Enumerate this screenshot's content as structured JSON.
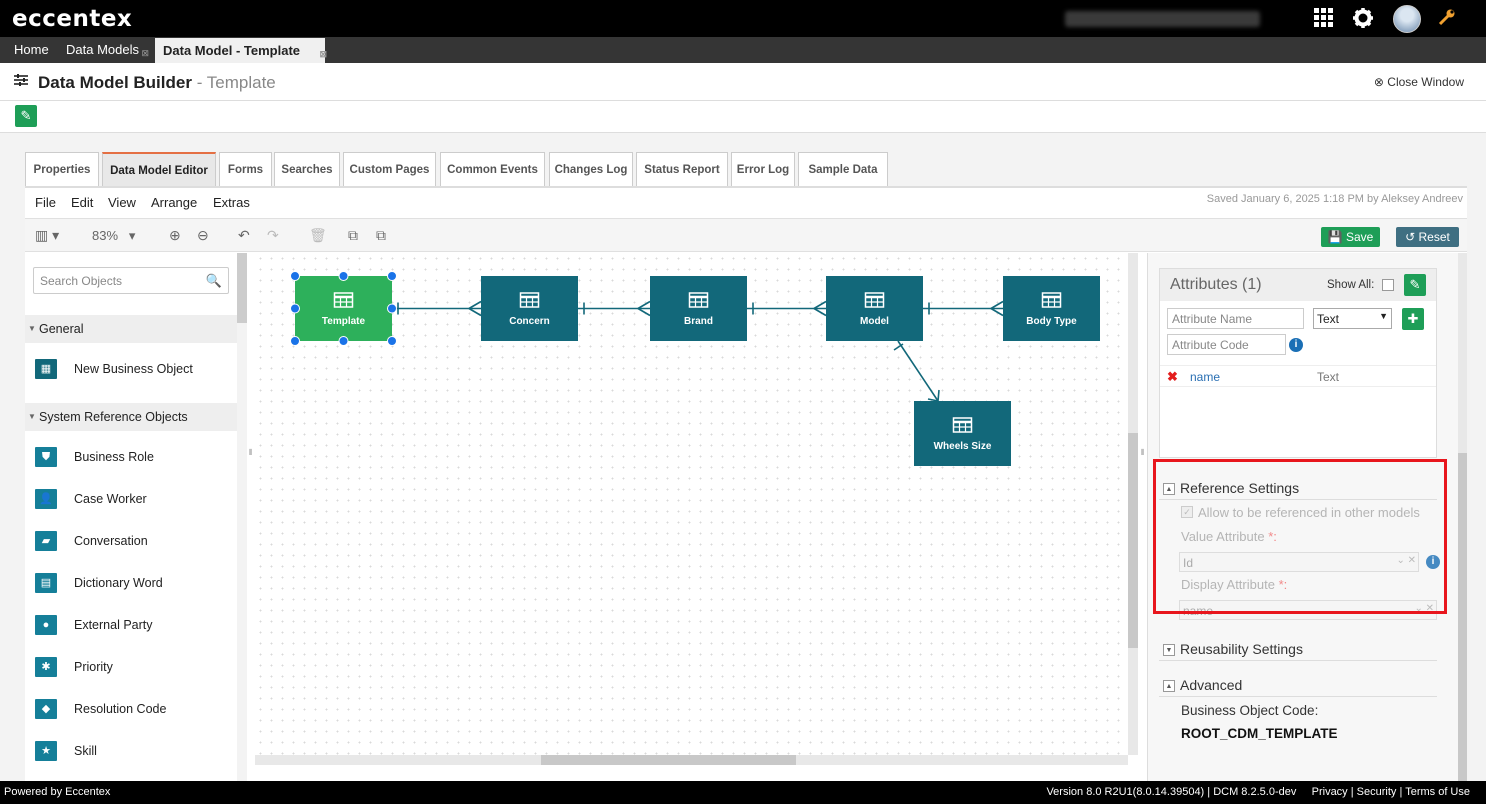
{
  "app": {
    "logo": "eccentex"
  },
  "topbar": {
    "icons": [
      "grid-icon",
      "gear-icon",
      "avatar",
      "wrench-icon"
    ]
  },
  "tabs": [
    {
      "label": "Home"
    },
    {
      "label": "Data Models"
    },
    {
      "label": "Data Model - Template"
    }
  ],
  "header": {
    "title": "Data Model Builder",
    "subtitle": "- Template",
    "close": "Close Window"
  },
  "main_tabs": [
    "Properties",
    "Data Model Editor",
    "Forms",
    "Searches",
    "Custom Pages",
    "Common Events",
    "Changes Log",
    "Status Report",
    "Error Log",
    "Sample Data"
  ],
  "menu": [
    "File",
    "Edit",
    "View",
    "Arrange",
    "Extras"
  ],
  "saved": "Saved January 6, 2025 1:18 PM by Aleksey Andreev",
  "toolbar": {
    "zoom": "83%",
    "save": "Save",
    "reset": "Reset"
  },
  "left": {
    "search_placeholder": "Search Objects",
    "group_general": "General",
    "new_bo": "New Business Object",
    "group_sys": "System Reference Objects",
    "items": [
      "Business Role",
      "Case Worker",
      "Conversation",
      "Dictionary Word",
      "External Party",
      "Priority",
      "Resolution Code",
      "Skill"
    ]
  },
  "diagram": {
    "entities": [
      "Template",
      "Concern",
      "Brand",
      "Model",
      "Body Type",
      "Wheels Size"
    ],
    "selected": "Template",
    "relations": [
      [
        "Template",
        "Concern"
      ],
      [
        "Concern",
        "Brand"
      ],
      [
        "Brand",
        "Model"
      ],
      [
        "Model",
        "Body Type"
      ],
      [
        "Model",
        "Wheels Size"
      ]
    ]
  },
  "attributes": {
    "title": "Attributes (1)",
    "show_all": "Show All:",
    "name_placeholder": "Attribute Name",
    "code_placeholder": "Attribute Code",
    "type": "Text",
    "rows": [
      {
        "name": "name",
        "type": "Text"
      }
    ]
  },
  "ref_settings": {
    "title": "Reference Settings",
    "allow": "Allow to be referenced in other models",
    "value_label": "Value Attribute",
    "value": "Id",
    "display_label": "Display Attribute",
    "display": "name",
    "required_mark": "*:"
  },
  "reuse": {
    "title": "Reusability Settings"
  },
  "advanced": {
    "title": "Advanced",
    "code_label": "Business Object Code:",
    "code": "ROOT_CDM_TEMPLATE"
  },
  "footer": {
    "powered": "Powered by Eccentex",
    "version": "Version   8.0 R2U1(8.0.14.39504) | DCM 8.2.5.0-dev",
    "privacy": "Privacy",
    "security": "Security",
    "terms": "Terms of Use"
  },
  "colors": {
    "entity": "#12687a",
    "selected": "#2db05b",
    "accent": "#1e9e57",
    "highlight": "#e8161d"
  }
}
